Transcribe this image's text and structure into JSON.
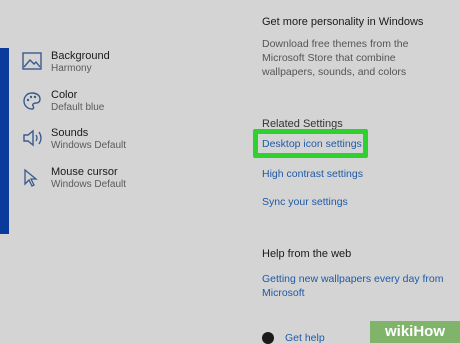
{
  "personalize": {
    "items": [
      {
        "label": "Background",
        "value": "Harmony",
        "icon": "image-icon"
      },
      {
        "label": "Color",
        "value": "Default blue",
        "icon": "palette-icon"
      },
      {
        "label": "Sounds",
        "value": "Windows Default",
        "icon": "speaker-icon"
      },
      {
        "label": "Mouse cursor",
        "value": "Windows Default",
        "icon": "cursor-icon"
      }
    ]
  },
  "store_section": {
    "title": "Get more personality in Windows",
    "body": "Download free themes from the Microsoft Store that combine wallpapers, sounds, and colors"
  },
  "related": {
    "title": "Related Settings",
    "links": [
      "Desktop icon settings",
      "High contrast settings",
      "Sync your settings"
    ]
  },
  "help": {
    "title": "Help from the web",
    "link": "Getting new wallpapers every day from Microsoft",
    "get_help": "Get help"
  },
  "colors": {
    "highlight": "#2fd12f",
    "link": "#1e5aa8",
    "accent_strip": "#0a3a9c"
  },
  "watermark": "wikiHow"
}
